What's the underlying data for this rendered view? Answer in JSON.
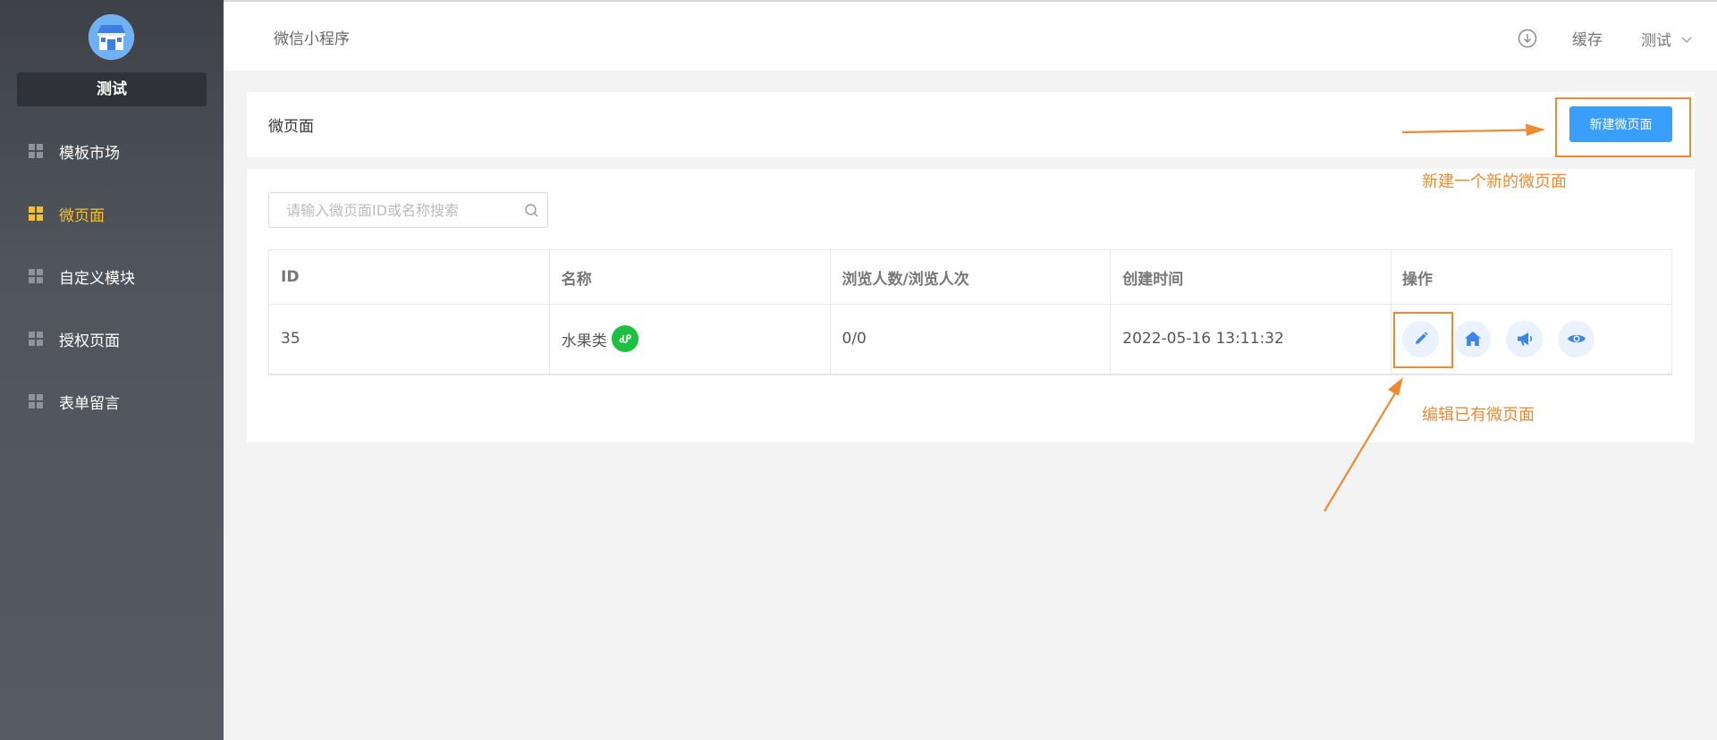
{
  "sidebar": {
    "store_name": "测试",
    "items": [
      {
        "label": "模板市场",
        "icon": "grid-icon",
        "active": false
      },
      {
        "label": "微页面",
        "icon": "grid-icon",
        "active": true
      },
      {
        "label": "自定义模块",
        "icon": "grid-icon",
        "active": false
      },
      {
        "label": "授权页面",
        "icon": "grid-icon",
        "active": false
      },
      {
        "label": "表单留言",
        "icon": "grid-icon",
        "active": false
      }
    ]
  },
  "header": {
    "title": "微信小程序",
    "download_icon": "download-icon",
    "cache_label": "缓存",
    "user_label": "测试"
  },
  "page": {
    "title": "微页面",
    "new_button_label": "新建微页面"
  },
  "search": {
    "placeholder": "请输入微页面ID或名称搜索"
  },
  "table": {
    "columns": [
      "ID",
      "名称",
      "浏览人数/浏览人次",
      "创建时间",
      "操作"
    ],
    "rows": [
      {
        "id": "35",
        "name": "水果类",
        "views": "0/0",
        "created": "2022-05-16 13:11:32",
        "actions": [
          "edit-icon",
          "home-icon",
          "megaphone-icon",
          "eye-icon"
        ]
      }
    ]
  },
  "annotations": {
    "new_page": "新建一个新的微页面",
    "edit_page": "编辑已有微页面",
    "color": "#f08a32"
  },
  "colors": {
    "accent": "#3a9efc",
    "active_nav": "#f7c02b",
    "sidebar_bg": "#50555c",
    "mini_program_green": "#1bc13f"
  }
}
